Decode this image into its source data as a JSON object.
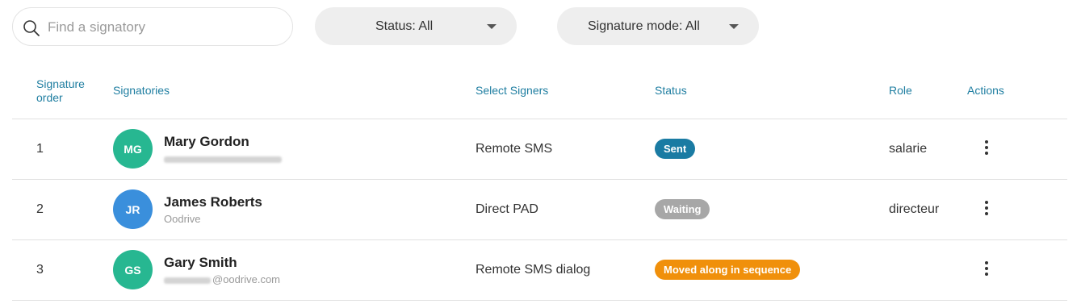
{
  "search": {
    "placeholder": "Find a signatory",
    "value": ""
  },
  "filters": {
    "status_label": "Status: All",
    "mode_label": "Signature mode: All"
  },
  "table": {
    "headers": {
      "order": "Signature order",
      "signatories": "Signatories",
      "select_signers": "Select Signers",
      "status": "Status",
      "role": "Role",
      "actions": "Actions"
    },
    "rows": [
      {
        "order": "1",
        "initials": "MG",
        "avatar_color": "#27b791",
        "name": "Mary Gordon",
        "sub_visible": "",
        "signer": "Remote SMS",
        "status": "Sent",
        "status_color": "#1a7ba3",
        "role": "salarie"
      },
      {
        "order": "2",
        "initials": "JR",
        "avatar_color": "#3a8fdc",
        "name": "James Roberts",
        "sub_visible": "Oodrive",
        "signer": "Direct PAD",
        "status": "Waiting",
        "status_color": "#a7a7a7",
        "role": "directeur"
      },
      {
        "order": "3",
        "initials": "GS",
        "avatar_color": "#27b791",
        "name": "Gary Smith",
        "sub_visible": "@oodrive.com",
        "signer": "Remote SMS dialog",
        "status": "Moved along in sequence",
        "status_color": "#f0900b",
        "role": ""
      }
    ]
  },
  "icons": {
    "search": "search-icon",
    "caret": "chevron-down-icon",
    "actions": "more-vertical-icon"
  }
}
